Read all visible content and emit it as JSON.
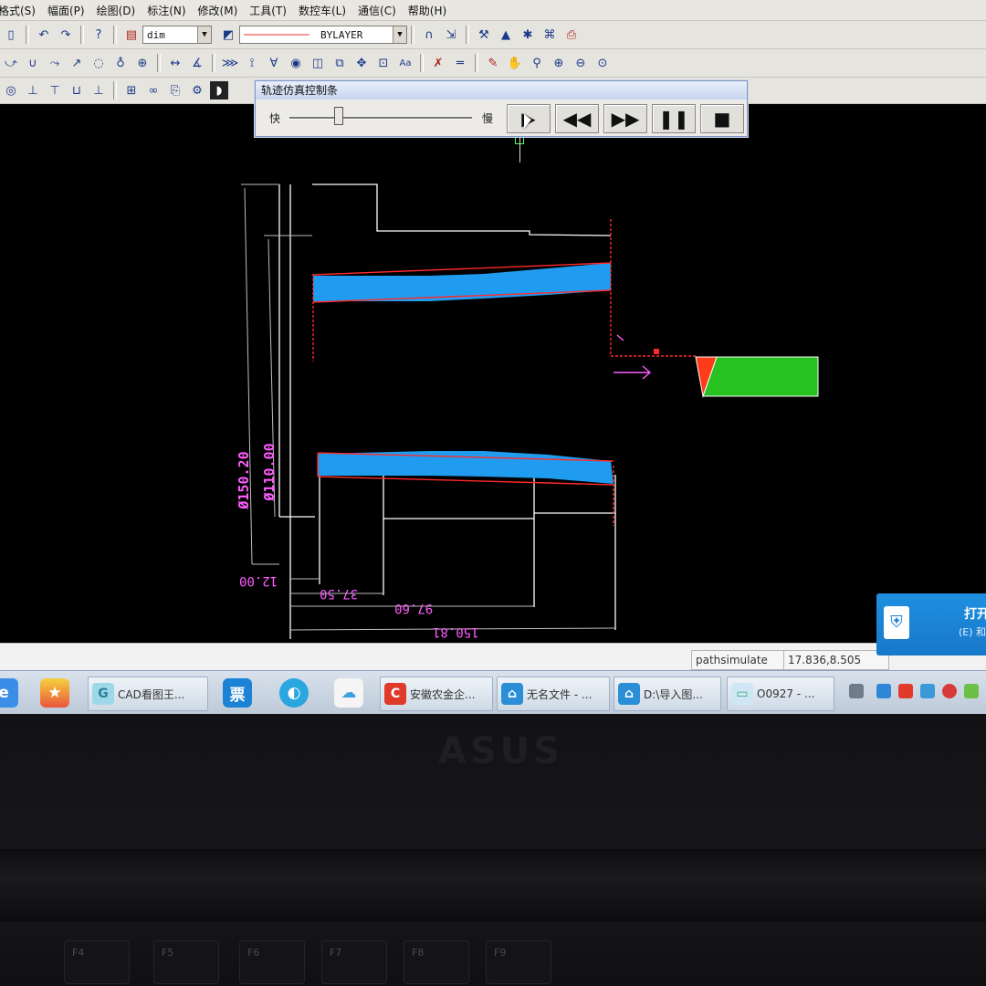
{
  "menu": {
    "items": [
      "格式(S)",
      "幅面(P)",
      "绘图(D)",
      "标注(N)",
      "修改(M)",
      "工具(T)",
      "数控车(L)",
      "通信(C)",
      "帮助(H)"
    ]
  },
  "toolbar": {
    "layer_value": "dim",
    "linetype_value": "BYLAYER"
  },
  "sim_bar": {
    "title": "轨迹仿真控制条",
    "fast_label": "快",
    "slow_label": "慢",
    "speed_fraction": 0.27,
    "buttons": [
      "play",
      "rewind",
      "fast-forward",
      "pause",
      "stop"
    ]
  },
  "drawing": {
    "colors": {
      "workpiece": "#1f9cf0",
      "tool_body": "#27c21f",
      "tool_tip": "#ff3b1a",
      "path": "#ff2a2a",
      "dimension": "#ff5cff",
      "outline": "#ffffff"
    },
    "dimensions": {
      "outer_diameter": "Ø150.20",
      "inner_diameter": "Ø110.00",
      "dim_12": "12.00",
      "dim_37": "37.50",
      "dim_97": "97.60",
      "dim_total": "150.81"
    }
  },
  "status": {
    "command": "pathsimulate",
    "coords": "17.836,8.505"
  },
  "taskbar": {
    "tasks": [
      {
        "label": "CAD看图王..."
      },
      {
        "label": "安徽农金企..."
      },
      {
        "label": "无名文件 - ..."
      },
      {
        "label": "D:\\导入图..."
      },
      {
        "label": "O0927 - ..."
      }
    ]
  },
  "notification": {
    "text": "打开",
    "sub": "(E) 和"
  },
  "laptop": {
    "brand": "ASUS",
    "keys": [
      "F4",
      "F5",
      "F6",
      "F7",
      "F8",
      "F9"
    ]
  }
}
